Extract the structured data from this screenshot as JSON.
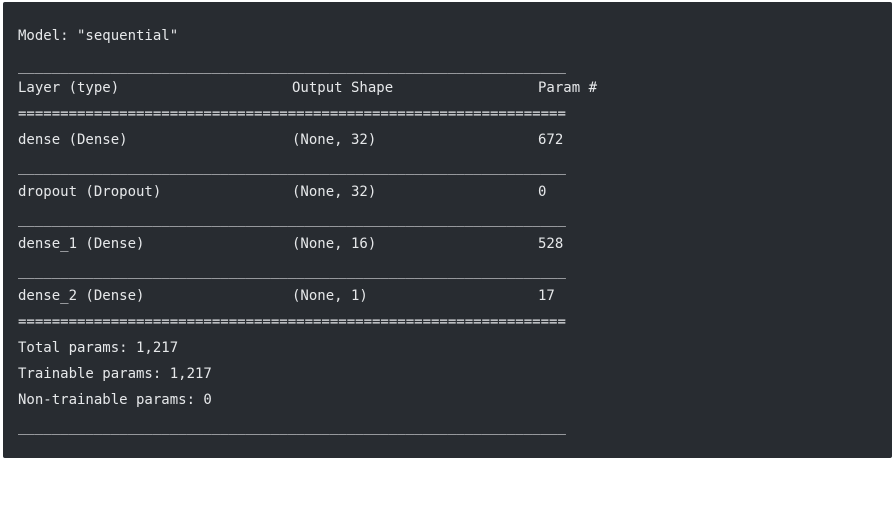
{
  "model_line": "Model: \"sequential\"",
  "separators": {
    "dash": "_________________________________________________________________",
    "equals": "================================================================="
  },
  "columns": [
    "Layer (type)",
    "Output Shape",
    "Param #"
  ],
  "rows": [
    {
      "layer": "dense (Dense)",
      "shape": "(None, 32)",
      "params": "672"
    },
    {
      "layer": "dropout (Dropout)",
      "shape": "(None, 32)",
      "params": "0"
    },
    {
      "layer": "dense_1 (Dense)",
      "shape": "(None, 16)",
      "params": "528"
    },
    {
      "layer": "dense_2 (Dense)",
      "shape": "(None, 1)",
      "params": "17"
    }
  ],
  "totals": {
    "total": "Total params: 1,217",
    "trainable": "Trainable params: 1,217",
    "non_trainable": "Non-trainable params: 0"
  }
}
